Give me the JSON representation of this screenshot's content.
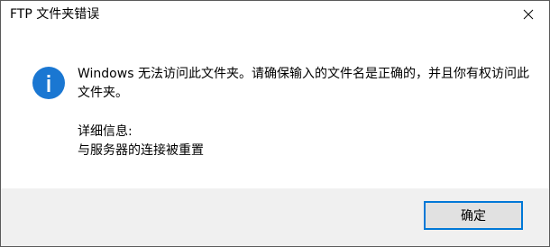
{
  "window": {
    "title": "FTP 文件夹错误"
  },
  "dialog": {
    "icon": "info-icon",
    "message": "Windows 无法访问此文件夹。请确保输入的文件名是正确的，并且你有权访问此文件夹。",
    "details_label": "详细信息:",
    "details_text": "与服务器的连接被重置"
  },
  "footer": {
    "ok_label": "确定"
  },
  "colors": {
    "info_icon_fill": "#1a77d2",
    "accent": "#0078d7",
    "footer_bg": "#f0f0f0",
    "button_bg": "#e1e1e1"
  }
}
